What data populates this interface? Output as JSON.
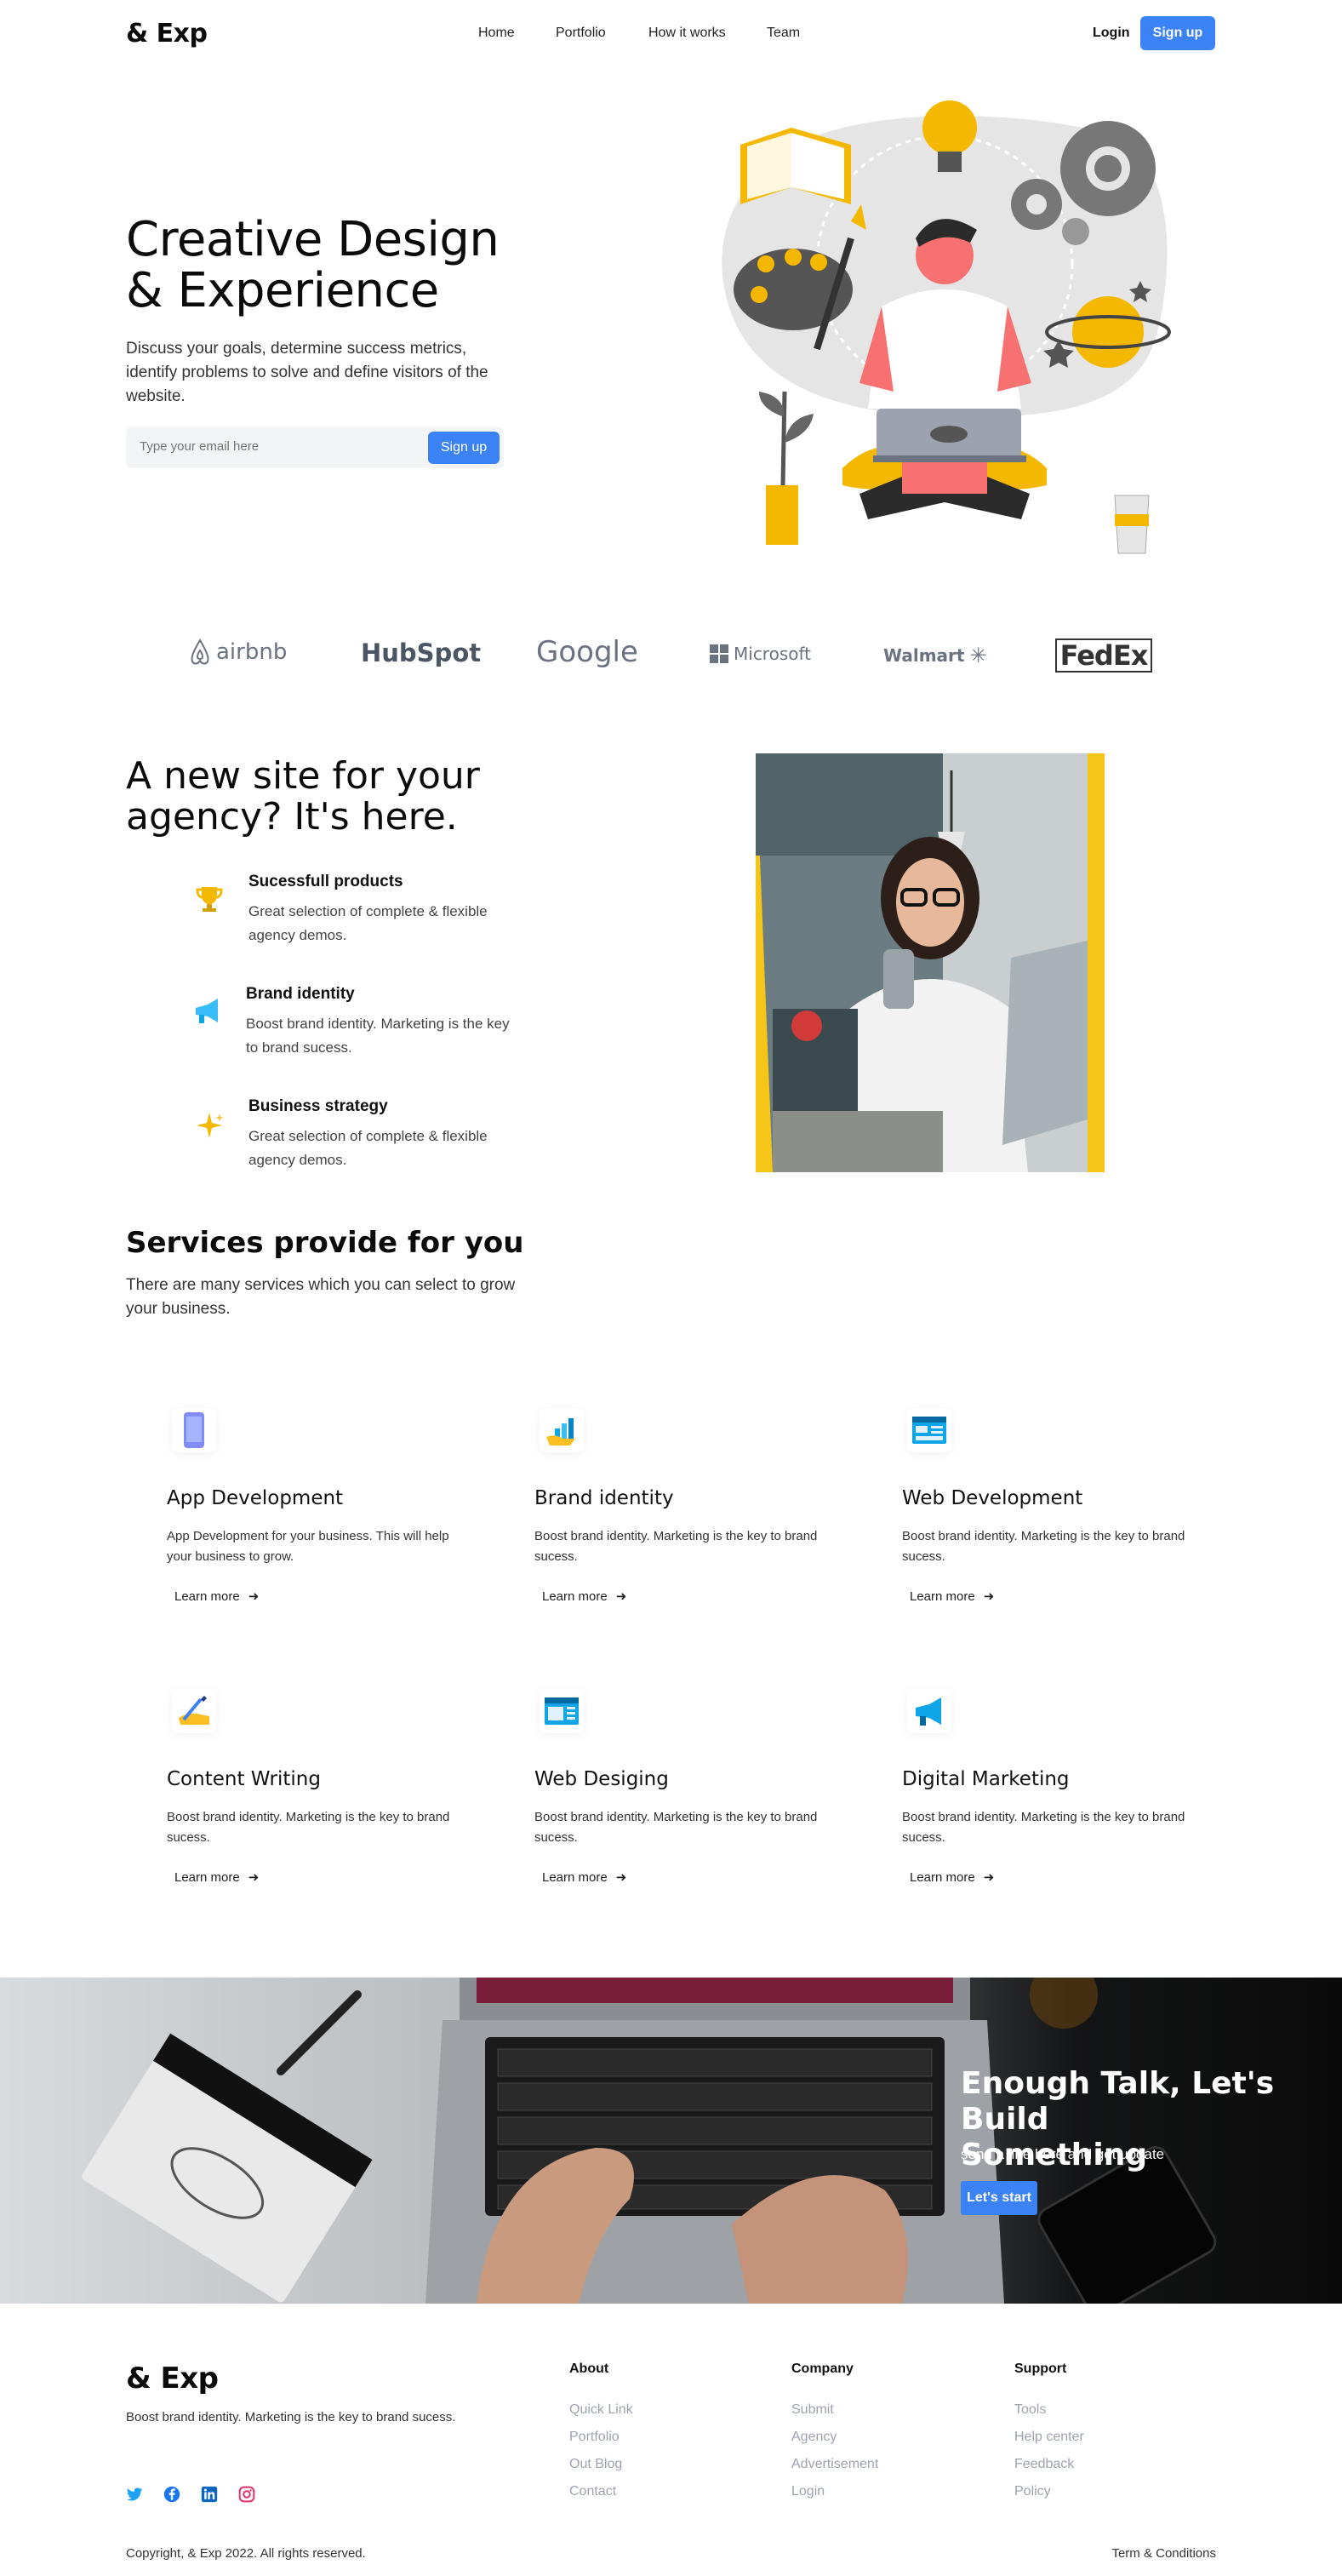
{
  "colors": {
    "accent": "#3b82f6",
    "yellow": "#f5b800",
    "text": "#111827"
  },
  "nav": {
    "logo": "& Exp",
    "links": [
      "Home",
      "Portfolio",
      "How it works",
      "Team"
    ],
    "login": "Login",
    "signup": "Sign up"
  },
  "hero": {
    "title_line1": "Creative Design",
    "title_line2": "& Experience",
    "subtitle": "Discuss your goals, determine success metrics, identify problems to solve and define visitors of the website.",
    "email_placeholder": "Type your email here",
    "signup": "Sign up"
  },
  "brands": [
    "airbnb",
    "HubSpot",
    "Google",
    "Microsoft",
    "Walmart",
    "FedEx"
  ],
  "features": {
    "title_line1": "A new site for your",
    "title_line2": "agency? It's here.",
    "items": [
      {
        "icon": "trophy-icon",
        "title": "Sucessfull products",
        "desc": "Great selection of complete & flexible agency demos."
      },
      {
        "icon": "megaphone-icon",
        "title": "Brand identity",
        "desc": "Boost brand identity. Marketing is the key to brand sucess."
      },
      {
        "icon": "sparkle-icon",
        "title": "Business strategy",
        "desc": "Great selection of complete & flexible agency demos."
      }
    ]
  },
  "services": {
    "title": "Services provide for you",
    "subtitle": "There are many services which you can select to grow your business.",
    "learn_more": "Learn more",
    "cards": [
      {
        "icon": "phone-icon",
        "title": "App Development",
        "desc": "App Development for your business. This will help your business to grow."
      },
      {
        "icon": "chart-hand-icon",
        "title": "Brand identity",
        "desc": "Boost brand identity. Marketing is the key to brand sucess."
      },
      {
        "icon": "browser-icon",
        "title": "Web Development",
        "desc": "Boost brand identity. Marketing is the key to brand sucess."
      },
      {
        "icon": "writing-hand-icon",
        "title": "Content Writing",
        "desc": "Boost brand identity. Marketing is the key to brand sucess."
      },
      {
        "icon": "webpage-icon",
        "title": "Web Desiging",
        "desc": "Boost brand identity. Marketing is the key to brand sucess."
      },
      {
        "icon": "megaphone-icon",
        "title": "Digital Marketing",
        "desc": "Boost brand identity. Marketing is the key to brand sucess."
      }
    ]
  },
  "cta": {
    "title_line1": "Enough Talk, Let's Build",
    "title_line2": "Something",
    "subtitle": "send a line here and get update",
    "button": "Let's start"
  },
  "footer": {
    "logo": "& Exp",
    "desc": "Boost brand identity. Marketing is the key to brand sucess.",
    "columns": [
      {
        "title": "About",
        "links": [
          "Quick Link",
          "Portfolio",
          "Out Blog",
          "Contact"
        ]
      },
      {
        "title": "Company",
        "links": [
          "Submit",
          "Agency",
          "Advertisement",
          "Login"
        ]
      },
      {
        "title": "Support",
        "links": [
          "Tools",
          "Help center",
          "Feedback",
          "Policy"
        ]
      }
    ],
    "social": [
      "twitter-icon",
      "facebook-icon",
      "linkedin-icon",
      "instagram-icon"
    ],
    "copyright": "Copyright, & Exp 2022. All rights reserved.",
    "terms": "Term & Conditions"
  }
}
